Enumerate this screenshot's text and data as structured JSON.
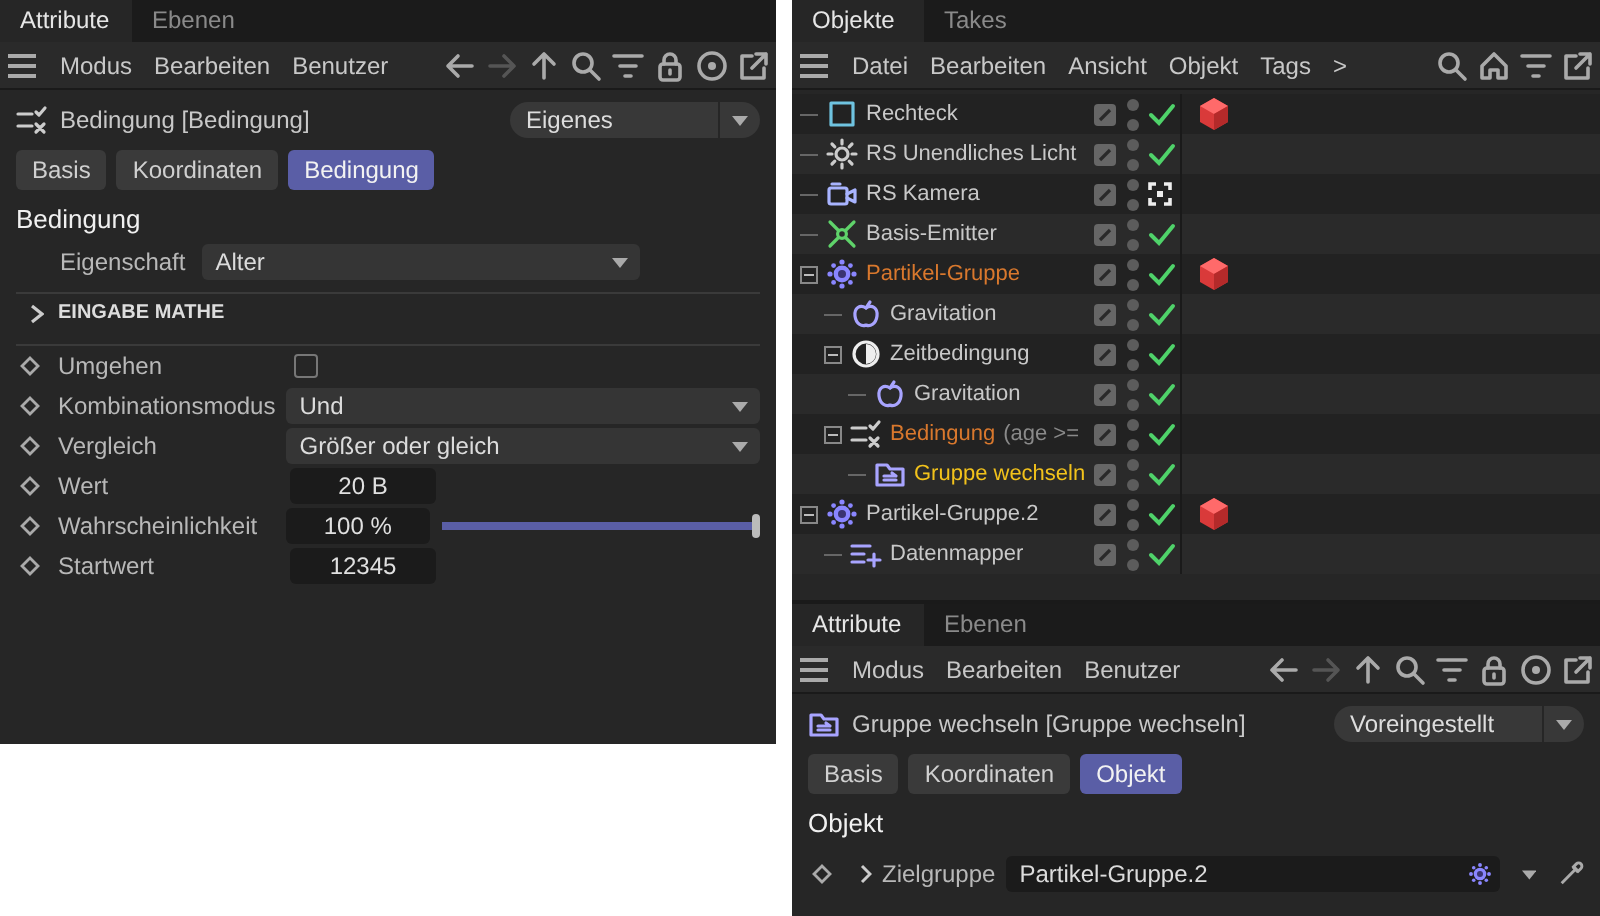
{
  "attribute_panel": {
    "tabs": [
      {
        "label": "Attribute",
        "selected": true
      },
      {
        "label": "Ebenen",
        "selected": false
      }
    ],
    "menu": [
      "Modus",
      "Bearbeiten",
      "Benutzer"
    ],
    "object": {
      "kind": "condition",
      "title": "Bedingung [Bedingung]"
    },
    "preset": "Eigenes",
    "subtabs": [
      {
        "label": "Basis",
        "selected": false
      },
      {
        "label": "Koordinaten",
        "selected": false
      },
      {
        "label": "Bedingung",
        "selected": true
      }
    ],
    "section": "Bedingung",
    "property": {
      "label": "Eigenschaft",
      "value": "Alter"
    },
    "group": {
      "label": "EINGABE MATHE",
      "expanded": false
    },
    "params": [
      {
        "kind": "checkbox",
        "label": "Umgehen",
        "checked": false
      },
      {
        "kind": "dropdown",
        "label": "Kombinationsmodus",
        "value": "Und"
      },
      {
        "kind": "dropdown",
        "label": "Vergleich",
        "value": "Größer oder gleich"
      },
      {
        "kind": "number",
        "label": "Wert",
        "value": "20 B"
      },
      {
        "kind": "slider",
        "label": "Wahrscheinlichkeit",
        "value": "100 %",
        "level": 1
      },
      {
        "kind": "number",
        "label": "Startwert",
        "value": "12345"
      }
    ]
  },
  "object_panel": {
    "tabs": [
      {
        "label": "Objekte",
        "selected": true
      },
      {
        "label": "Takes",
        "selected": false
      }
    ],
    "menu": [
      "Datei",
      "Bearbeiten",
      "Ansicht",
      "Objekt",
      "Tags",
      ">"
    ],
    "tree": [
      {
        "name": "Rechteck",
        "kind": "rectangle",
        "color": "#c8c8c8",
        "enabled": true,
        "tag": true
      },
      {
        "name": "RS Unendliches Licht",
        "kind": "light",
        "color": "#c8c8c8",
        "enabled": true,
        "tag": false
      },
      {
        "name": "RS Kamera",
        "kind": "camera",
        "color": "#c8c8c8",
        "enabled": true,
        "tag": false
      },
      {
        "name": "Basis-Emitter",
        "kind": "emitter",
        "color": "#c8c8c8",
        "enabled": true,
        "tag": false
      },
      {
        "name": "Partikel-Gruppe",
        "kind": "particle-group",
        "color": "#d9782d",
        "enabled": true,
        "tag": true,
        "expanded": true,
        "children": [
          {
            "name": "Gravitation",
            "kind": "gravity",
            "color": "#c8c8c8",
            "enabled": true,
            "tag": false
          },
          {
            "name": "Zeitbedingung",
            "kind": "time",
            "color": "#c8c8c8",
            "enabled": true,
            "tag": false,
            "expanded": true,
            "children": [
              {
                "name": "Gravitation",
                "kind": "gravity",
                "color": "#c8c8c8",
                "enabled": true,
                "tag": false
              }
            ]
          },
          {
            "name": "Bedingung",
            "note": "(age >=",
            "kind": "condition",
            "color": "#d9782d",
            "enabled": true,
            "tag": false,
            "expanded": true,
            "children": [
              {
                "name": "Gruppe wechseln",
                "kind": "switch-group",
                "color": "#f2c21b",
                "enabled": true,
                "tag": false
              }
            ]
          }
        ]
      },
      {
        "name": "Partikel-Gruppe.2",
        "kind": "particle-group",
        "color": "#c8c8c8",
        "enabled": true,
        "tag": true,
        "expanded": true,
        "children": [
          {
            "name": "Datenmapper",
            "kind": "data-mapper",
            "color": "#c8c8c8",
            "enabled": true,
            "tag": false
          }
        ]
      }
    ]
  },
  "attribute_panel_2": {
    "tabs": [
      {
        "label": "Attribute",
        "selected": true
      },
      {
        "label": "Ebenen",
        "selected": false
      }
    ],
    "menu": [
      "Modus",
      "Bearbeiten",
      "Benutzer"
    ],
    "object": {
      "kind": "switch-group",
      "title": "Gruppe wechseln [Gruppe wechseln]"
    },
    "preset": "Voreingestellt",
    "subtabs": [
      {
        "label": "Basis",
        "selected": false
      },
      {
        "label": "Koordinaten",
        "selected": false
      },
      {
        "label": "Objekt",
        "selected": true
      }
    ],
    "section": "Objekt",
    "link": {
      "label": "Zielgruppe",
      "value": "Partikel-Gruppe.2"
    }
  }
}
